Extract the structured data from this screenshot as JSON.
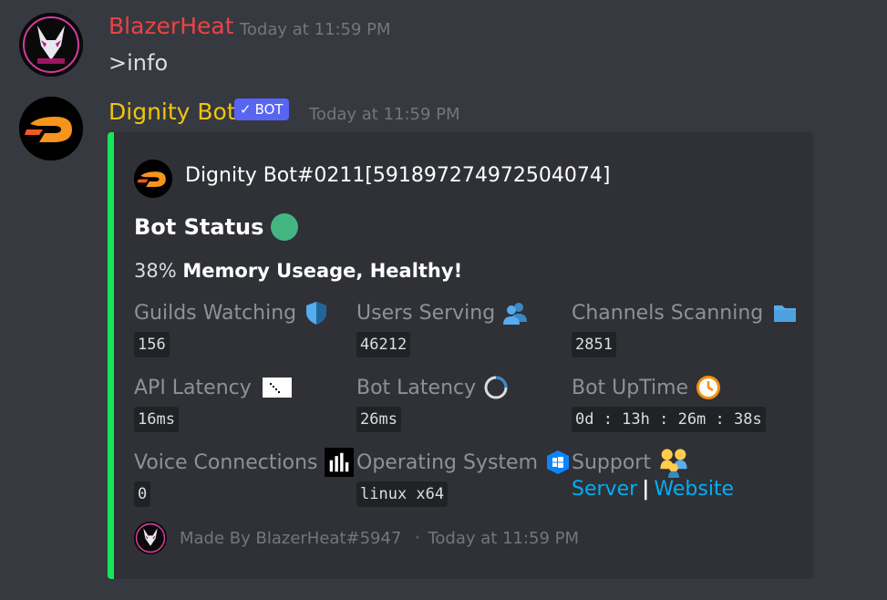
{
  "messages": [
    {
      "username": "BlazerHeat",
      "username_color": "#ed4245",
      "timestamp": "Today at 11:59 PM",
      "text": ">info"
    },
    {
      "username": "Dignity Bot",
      "username_color": "#f1c40f",
      "bot_tag": "BOT",
      "timestamp": "Today at 11:59 PM"
    }
  ],
  "embed": {
    "accent_color": "#18e55b",
    "author": "Dignity Bot#0211[591897274972504074]",
    "title": "Bot Status",
    "description_value": "38%",
    "description_bold": "Memory Useage, Healthy!",
    "fields": [
      {
        "name": "Guilds Watching",
        "icon": "shield-icon",
        "value": "156"
      },
      {
        "name": "Users Serving",
        "icon": "users-icon",
        "value": "46212"
      },
      {
        "name": "Channels Scanning",
        "icon": "folder-icon",
        "value": "2851"
      },
      {
        "name": "API Latency",
        "icon": "latency-icon",
        "value": "16ms"
      },
      {
        "name": "Bot Latency",
        "icon": "loading-icon",
        "value": "26ms"
      },
      {
        "name": "Bot UpTime",
        "icon": "clock-icon",
        "value": "0d : 13h : 26m : 38s"
      },
      {
        "name": "Voice Connections",
        "icon": "bars-icon",
        "value": "0"
      },
      {
        "name": "Operating System",
        "icon": "windows-icon",
        "value": "linux x64"
      },
      {
        "name": "Support",
        "icon": "family-icon"
      }
    ],
    "support_links": {
      "server": "Server",
      "separator": "|",
      "website": "Website"
    },
    "footer_text": "Made By BlazerHeat#5947",
    "footer_separator": "•",
    "footer_timestamp": "Today at 11:59 PM"
  }
}
